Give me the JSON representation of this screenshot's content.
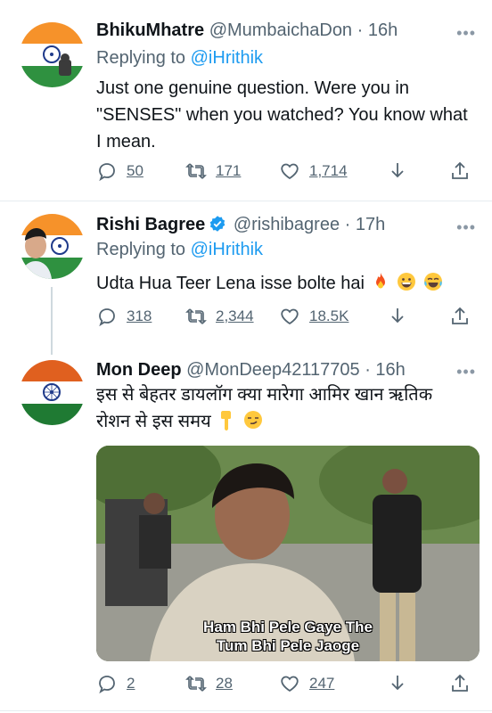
{
  "tweets": [
    {
      "name": "BhikuMhatre",
      "handle": "@MumbaichaDon",
      "time": "· 16h",
      "replying_prefix": "Replying to ",
      "replying_to": "@iHrithik",
      "text": "Just one genuine question. Were you in \"SENSES\" when you watched? You know what I mean.",
      "replies": "50",
      "retweets": "171",
      "likes": "1,714"
    },
    {
      "name": "Rishi Bagree",
      "verified": true,
      "handle": "@rishibagree",
      "time": "· 17h",
      "replying_prefix": "Replying to ",
      "replying_to": "@iHrithik",
      "text": "Udta Hua Teer Lena isse bolte hai",
      "emojis": [
        "fire-emoji",
        "grin-emoji",
        "tears-of-joy-emoji"
      ],
      "replies": "318",
      "retweets": "2,344",
      "likes": "18.5K"
    },
    {
      "name": "Mon Deep",
      "handle": "@MonDeep42117705",
      "time": "· 16h",
      "text_line1": "इस से बेहतर डायलॉग क्या मारेगा आमिर खान ऋतिक",
      "text_line2": "रोशन से इस समय",
      "emojis": [
        "point-down-emoji",
        "smirk-emoji"
      ],
      "media_caption_line1": "Ham Bhi Pele Gaye The",
      "media_caption_line2": "Tum Bhi Pele Jaoge",
      "replies": "2",
      "retweets": "28",
      "likes": "247"
    }
  ],
  "colors": {
    "accent": "#1d9bf0",
    "muted": "#536471",
    "text": "#0f1419",
    "saffron": "#f6922a",
    "green": "#2f9140",
    "chakra": "#1f3a8a"
  }
}
